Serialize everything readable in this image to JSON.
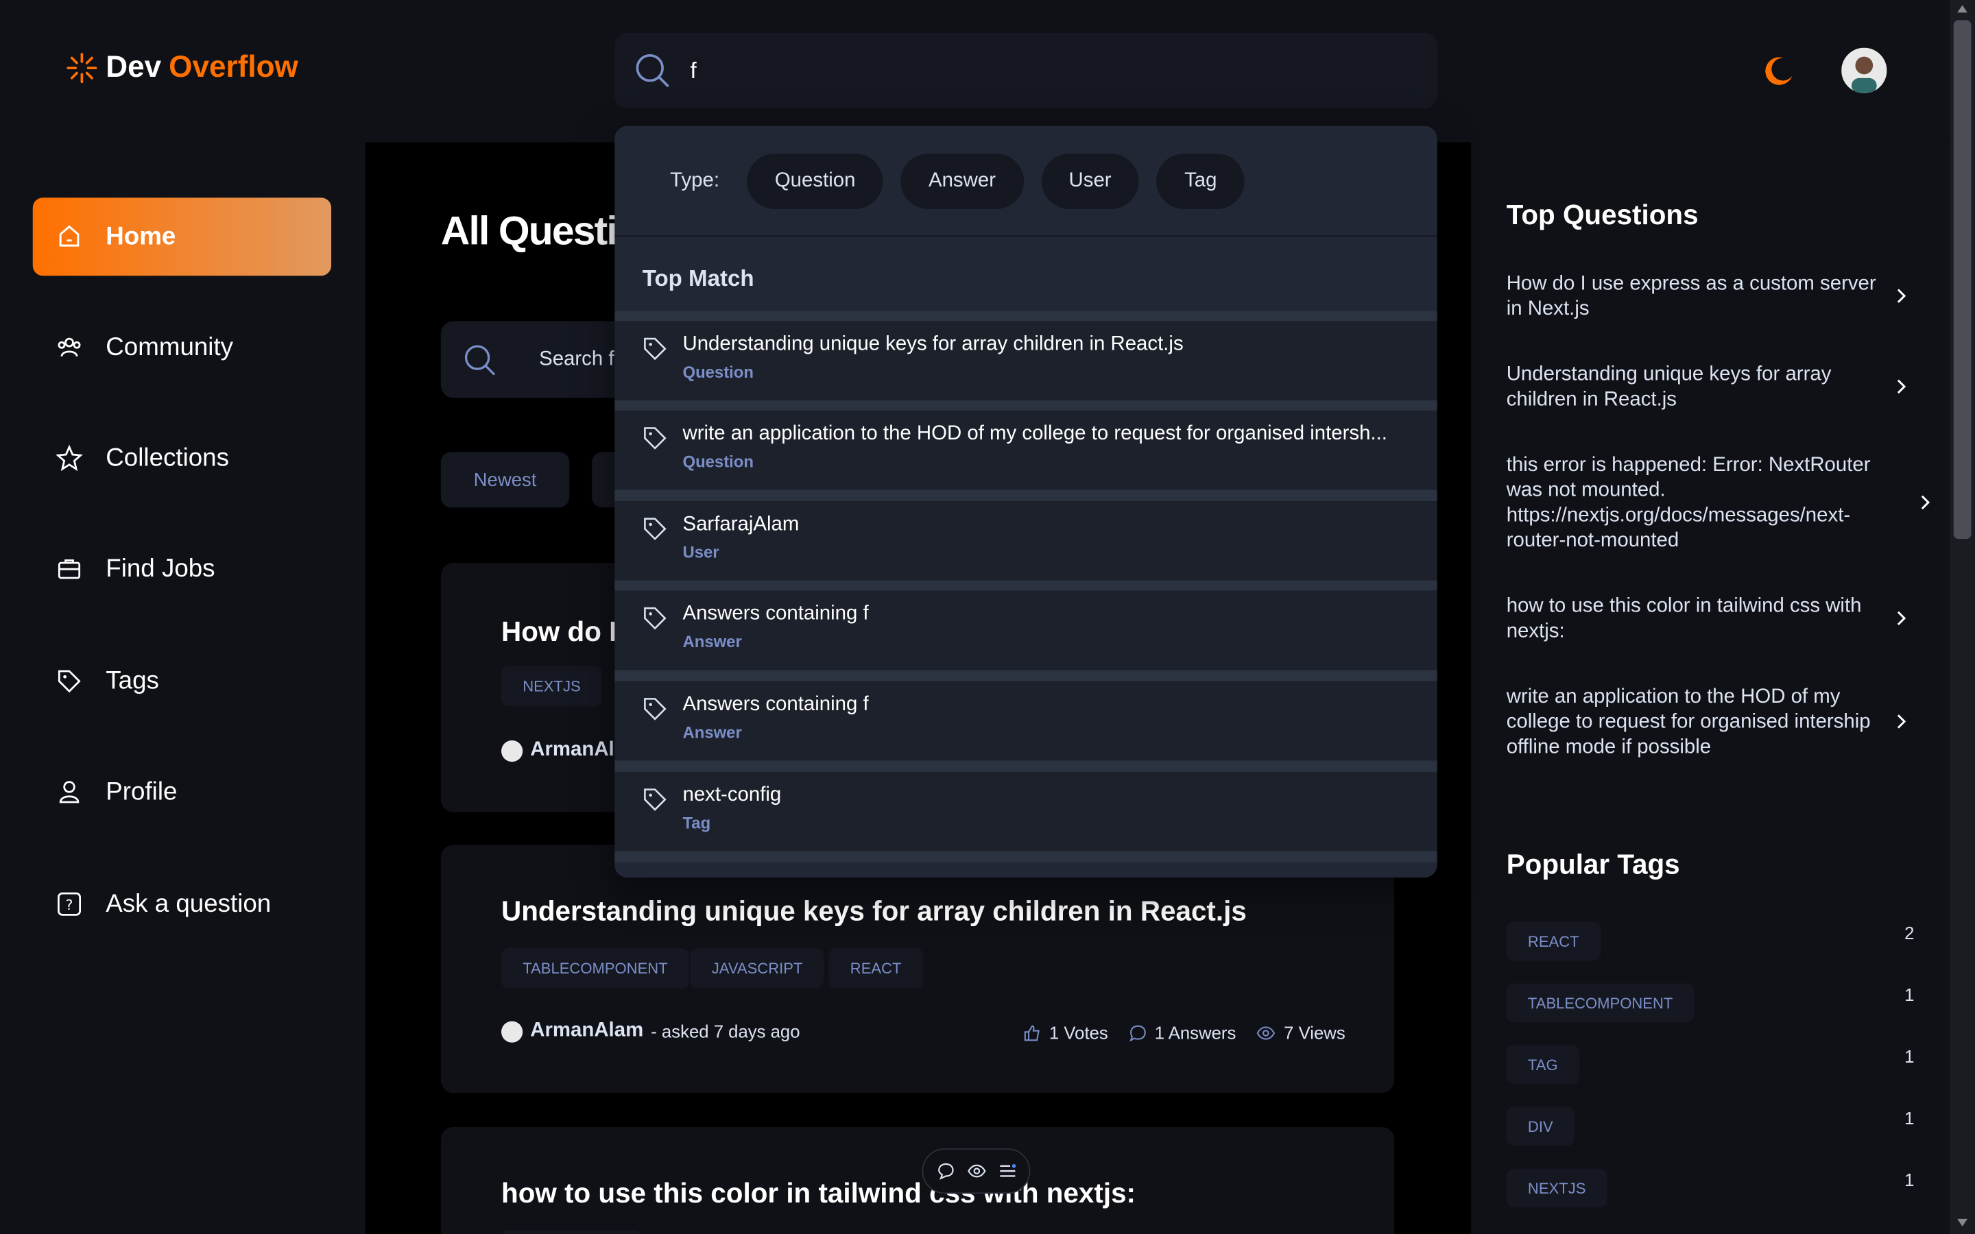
{
  "brand": {
    "part1": "Dev",
    "part2": "Overflow",
    "accent": "#ff7000"
  },
  "global_search": {
    "value": "f"
  },
  "left_nav": [
    {
      "label": "Home",
      "icon": "home-icon"
    },
    {
      "label": "Community",
      "icon": "community-icon"
    },
    {
      "label": "Collections",
      "icon": "star-icon"
    },
    {
      "label": "Find Jobs",
      "icon": "briefcase-icon"
    },
    {
      "label": "Tags",
      "icon": "tag-icon"
    },
    {
      "label": "Profile",
      "icon": "user-icon"
    },
    {
      "label": "Ask a question",
      "icon": "question-icon"
    }
  ],
  "main": {
    "title": "All Questi",
    "local_search_placeholder": "Search fo",
    "filters": [
      "Newest"
    ],
    "cards": [
      {
        "title": "How do I",
        "tags": [
          "NEXTJS"
        ],
        "author": "ArmanAl"
      },
      {
        "title": "Understanding unique keys for array children in React.js",
        "tags": [
          "TABLECOMPONENT",
          "JAVASCRIPT",
          "REACT"
        ],
        "author": "ArmanAlam",
        "asked": "- asked 7 days ago",
        "votes": "1 Votes",
        "answers": "1 Answers",
        "views": "7 Views"
      },
      {
        "title": "how to use this color in tailwind css with nextjs:"
      }
    ]
  },
  "dropdown": {
    "type_label": "Type:",
    "types": [
      "Question",
      "Answer",
      "User",
      "Tag"
    ],
    "top_match_label": "Top Match",
    "results": [
      {
        "title": "Understanding unique keys for array children in React.js",
        "kind": "Question"
      },
      {
        "title": "write an application to the HOD of my college to request for organised intersh...",
        "kind": "Question"
      },
      {
        "title": "SarfarajAlam",
        "kind": "User"
      },
      {
        "title": "Answers containing f",
        "kind": "Answer"
      },
      {
        "title": "Answers containing f",
        "kind": "Answer"
      },
      {
        "title": "next-config",
        "kind": "Tag"
      }
    ]
  },
  "right_sidebar": {
    "top_questions_heading": "Top Questions",
    "top_questions": [
      "How do I use express as a custom server in Next.js",
      "Understanding unique keys for array children in React.js",
      "this error is happened: Error: NextRouter was not mounted. https://nextjs.org/docs/messages/next-router-not-mounted",
      "how to use this color in tailwind css with nextjs:",
      "write an application to the HOD of my college to request for organised intership offline mode if possible"
    ],
    "popular_tags_heading": "Popular Tags",
    "popular_tags": [
      {
        "name": "REACT",
        "count": "2"
      },
      {
        "name": "TABLECOMPONENT",
        "count": "1"
      },
      {
        "name": "TAG",
        "count": "1"
      },
      {
        "name": "DIV",
        "count": "1"
      },
      {
        "name": "NEXTJS",
        "count": "1"
      }
    ]
  }
}
